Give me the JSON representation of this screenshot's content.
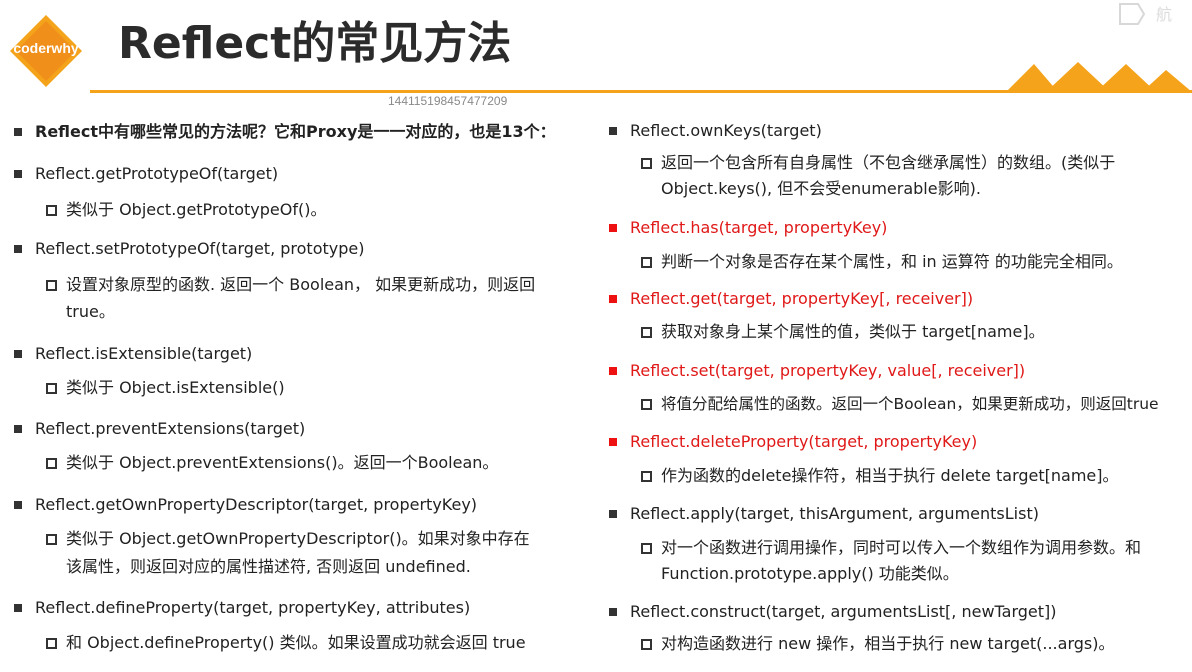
{
  "header": {
    "logo_text": "coderwhy",
    "title": "Reflect的常见方法",
    "id_watermark": "144115198457477209"
  },
  "left": {
    "intro": "Reflect中有哪些常见的方法呢？它和Proxy是一一对应的，也是13个：",
    "items": [
      {
        "method": "Reflect.getPrototypeOf(target)",
        "desc": [
          "类似于 Object.getPrototypeOf()。"
        ]
      },
      {
        "method": "Reflect.setPrototypeOf(target, prototype)",
        "desc": [
          "设置对象原型的函数. 返回一个 Boolean， 如果更新成功，则返回",
          "true。"
        ]
      },
      {
        "method": "Reflect.isExtensible(target)",
        "desc": [
          "类似于 Object.isExtensible()"
        ]
      },
      {
        "method": "Reflect.preventExtensions(target)",
        "desc": [
          "类似于 Object.preventExtensions()。返回一个Boolean。"
        ]
      },
      {
        "method": "Reflect.getOwnPropertyDescriptor(target, propertyKey)",
        "desc": [
          "类似于 Object.getOwnPropertyDescriptor()。如果对象中存在",
          "该属性，则返回对应的属性描述符, 否则返回 undefined."
        ]
      },
      {
        "method": "Reflect.defineProperty(target, propertyKey, attributes)",
        "desc": [
          "和 Object.defineProperty() 类似。如果设置成功就会返回 true"
        ]
      }
    ]
  },
  "right": {
    "items": [
      {
        "method": "Reflect.ownKeys(target)",
        "highlight": false,
        "desc": [
          "返回一个包含所有自身属性（不包含继承属性）的数组。(类似于",
          "Object.keys(), 但不会受enumerable影响)."
        ]
      },
      {
        "method": "Reflect.has(target, propertyKey)",
        "highlight": true,
        "desc": [
          "判断一个对象是否存在某个属性，和 in 运算符 的功能完全相同。"
        ]
      },
      {
        "method": "Reflect.get(target, propertyKey[, receiver])",
        "highlight": true,
        "desc": [
          "获取对象身上某个属性的值，类似于 target[name]。"
        ]
      },
      {
        "method": "Reflect.set(target, propertyKey, value[, receiver])",
        "highlight": true,
        "desc": [
          "将值分配给属性的函数。返回一个Boolean，如果更新成功，则返回true"
        ]
      },
      {
        "method": "Reflect.deleteProperty(target, propertyKey)",
        "highlight": true,
        "desc": [
          "作为函数的delete操作符，相当于执行 delete target[name]。"
        ]
      },
      {
        "method": "Reflect.apply(target, thisArgument, argumentsList)",
        "highlight": false,
        "desc": [
          "对一个函数进行调用操作，同时可以传入一个数组作为调用参数。和",
          "Function.prototype.apply() 功能类似。"
        ]
      },
      {
        "method": "Reflect.construct(target, argumentsList[, newTarget])",
        "highlight": false,
        "desc": [
          "对构造函数进行 new 操作，相当于执行 new target(...args)。"
        ]
      }
    ]
  },
  "colors": {
    "accent": "#f5a31a",
    "highlight": "#e01818"
  }
}
